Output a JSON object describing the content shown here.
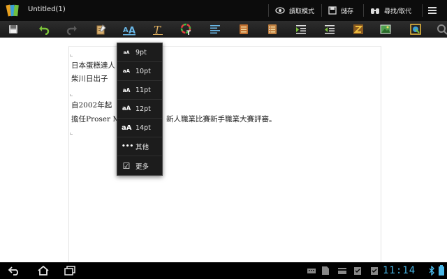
{
  "titlebar": {
    "title": "Untitled(1)",
    "read_mode_label": "讀取模式",
    "save_label": "儲存",
    "find_replace_label": "尋找/取代"
  },
  "toolbar": {
    "icons": [
      "save-icon",
      "undo-icon",
      "redo-icon",
      "edit-icon",
      "font-size-icon",
      "text-style-icon",
      "font-color-icon",
      "align-icon",
      "bullet-list-icon",
      "number-list-icon",
      "indent-icon",
      "outdent-icon",
      "format-icon",
      "insert-image-icon",
      "insert-shape-icon",
      "search-icon"
    ]
  },
  "document": {
    "lines": [
      "日本蛋糕達人",
      "柴川日出子",
      "自2002年起",
      "擔任Proser M",
      "新人職業比賽新手職業大賽評審。"
    ]
  },
  "font_menu": {
    "items": [
      {
        "icon": "aA",
        "label": "9pt"
      },
      {
        "icon": "aA",
        "label": "10pt"
      },
      {
        "icon": "aA",
        "label": "11pt"
      },
      {
        "icon": "aA",
        "label": "12pt"
      },
      {
        "icon": "aA",
        "label": "14pt"
      },
      {
        "icon": "•••",
        "label": "其他"
      },
      {
        "icon": "☑",
        "label": "更多"
      }
    ]
  },
  "statusbar": {
    "clock": "11:14"
  },
  "colors": {
    "clock": "#4ab8e8",
    "titlebar_bg": "#0c0c0c",
    "toolbar_bg": "#222222"
  }
}
